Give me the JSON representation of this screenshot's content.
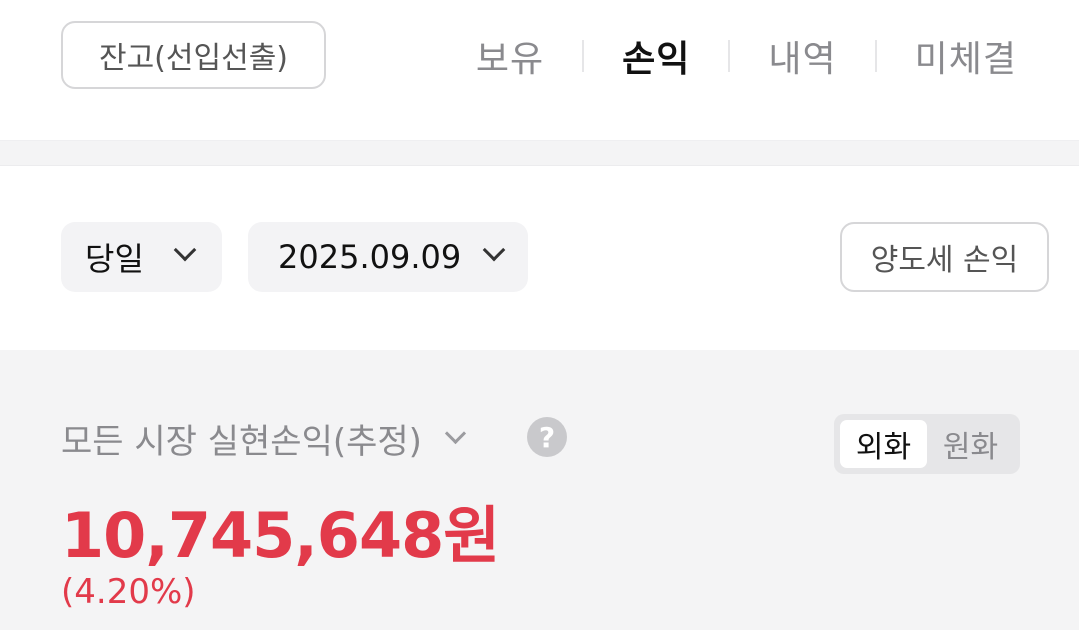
{
  "header": {
    "balance_button": "잔고(선입선출)",
    "tabs": [
      {
        "label": "보유",
        "active": false
      },
      {
        "label": "손익",
        "active": true
      },
      {
        "label": "내역",
        "active": false
      },
      {
        "label": "미체결",
        "active": false
      }
    ]
  },
  "filters": {
    "period": "당일",
    "date": "2025.09.09",
    "tax_button": "양도세 손익"
  },
  "summary": {
    "market_label": "모든 시장 실현손익(추정)",
    "help_icon": "?",
    "currency_toggle": [
      {
        "label": "외화",
        "selected": true
      },
      {
        "label": "원화",
        "selected": false
      }
    ],
    "amount": "10,745,648원",
    "rate": "(4.20%)"
  },
  "colors": {
    "profit_red": "#e23a4a",
    "background_gray": "#f4f4f5"
  }
}
